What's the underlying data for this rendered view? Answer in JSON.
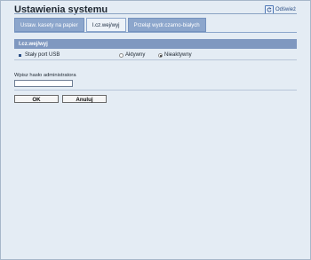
{
  "header": {
    "title": "Ustawienia systemu",
    "refresh_label": "Odśwież",
    "refresh_icon": "refresh-icon"
  },
  "tabs": [
    {
      "label": "Ustaw. kasety na papier",
      "active": false
    },
    {
      "label": "I.cz.wej/wyj",
      "active": true
    },
    {
      "label": "Przełąt wydr.czarno-białych",
      "active": false
    }
  ],
  "section": {
    "title": "I.cz.wej/wyj",
    "row": {
      "label": "Stały port USB",
      "options": [
        {
          "label": "Aktywny",
          "selected": false
        },
        {
          "label": "Nieaktywny",
          "selected": true
        }
      ]
    }
  },
  "password": {
    "label": "Wpisz hasło administratora",
    "value": ""
  },
  "buttons": {
    "ok": "OK",
    "cancel": "Anuluj"
  },
  "colors": {
    "accent": "#7f98c0",
    "tab_inactive": "#8ca6cc",
    "background": "#e4ecf4"
  }
}
